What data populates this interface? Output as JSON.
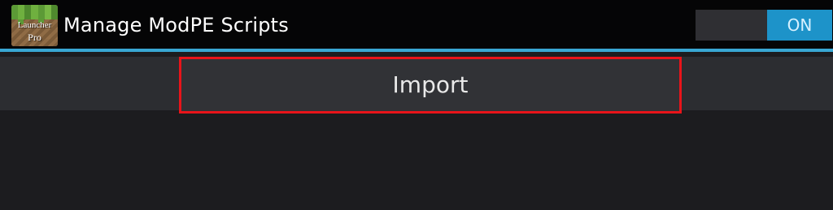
{
  "app": {
    "icon": {
      "name": "launcher-pro-icon",
      "text_line1": "Launcher",
      "text_line2": "Pro"
    },
    "title": "Manage ModPE Scripts"
  },
  "toggle": {
    "state_label": "ON",
    "on_color": "#1d93c9"
  },
  "actions": {
    "import_label": "Import"
  },
  "colors": {
    "accent_line": "#39a7d3",
    "highlight_border": "#e8141a"
  }
}
